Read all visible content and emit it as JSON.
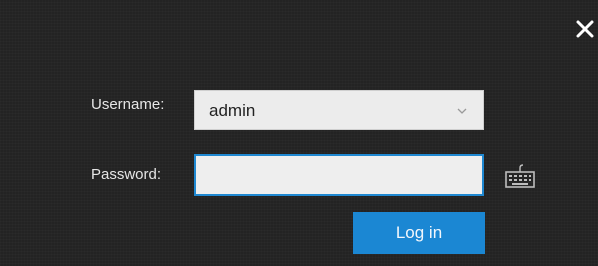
{
  "dialog": {
    "close_icon": "close-icon",
    "username": {
      "label": "Username:",
      "selected_value": "admin",
      "chevron_icon": "chevron-down-icon"
    },
    "password": {
      "label": "Password:",
      "value": "",
      "keyboard_icon": "keyboard-icon"
    },
    "login_button": {
      "label": "Log in"
    }
  },
  "colors": {
    "background": "#232323",
    "accent": "#1b87d3",
    "field_background": "#ececec",
    "label_text": "#e6e6e6"
  }
}
